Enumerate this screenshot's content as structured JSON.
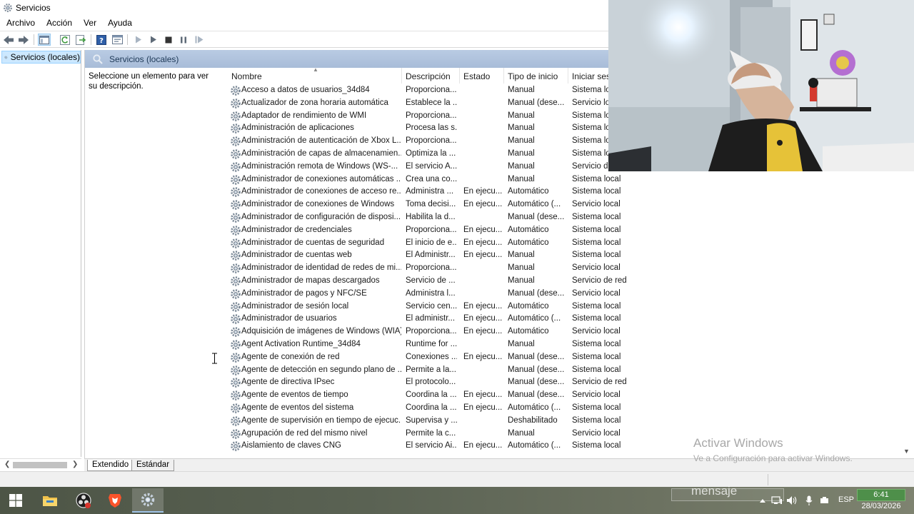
{
  "window": {
    "title": "Servicios"
  },
  "menu": [
    "Archivo",
    "Acción",
    "Ver",
    "Ayuda"
  ],
  "tree": {
    "item": "Servicios (locales)"
  },
  "panel": {
    "header": "Servicios (locales)",
    "description": "Seleccione un elemento para ver su descripción."
  },
  "columns": [
    "Nombre",
    "Descripción",
    "Estado",
    "Tipo de inicio",
    "Iniciar sesi"
  ],
  "services": [
    [
      "Acceso a datos de usuarios_34d84",
      "Proporciona...",
      "",
      "Manual",
      "Sistema lo"
    ],
    [
      "Actualizador de zona horaria automática",
      "Establece la ...",
      "",
      "Manual (dese...",
      "Servicio lo"
    ],
    [
      "Adaptador de rendimiento de WMI",
      "Proporciona...",
      "",
      "Manual",
      "Sistema lo"
    ],
    [
      "Administración de aplicaciones",
      "Procesa las s...",
      "",
      "Manual",
      "Sistema lo"
    ],
    [
      "Administración de autenticación de Xbox L...",
      "Proporciona...",
      "",
      "Manual",
      "Sistema lo"
    ],
    [
      "Administración de capas de almacenamien...",
      "Optimiza la ...",
      "",
      "Manual",
      "Sistema lo"
    ],
    [
      "Administración remota de Windows (WS-...",
      "El servicio A...",
      "",
      "Manual",
      "Servicio de"
    ],
    [
      "Administrador de conexiones automáticas ...",
      "Crea una co...",
      "",
      "Manual",
      "Sistema local"
    ],
    [
      "Administrador de conexiones de acceso re...",
      "Administra ...",
      "En ejecu...",
      "Automático",
      "Sistema local"
    ],
    [
      "Administrador de conexiones de Windows",
      "Toma decisi...",
      "En ejecu...",
      "Automático (...",
      "Servicio local"
    ],
    [
      "Administrador de configuración de disposi...",
      "Habilita la d...",
      "",
      "Manual (dese...",
      "Sistema local"
    ],
    [
      "Administrador de credenciales",
      "Proporciona...",
      "En ejecu...",
      "Automático",
      "Sistema local"
    ],
    [
      "Administrador de cuentas de seguridad",
      "El inicio de e...",
      "En ejecu...",
      "Automático",
      "Sistema local"
    ],
    [
      "Administrador de cuentas web",
      "El Administr...",
      "En ejecu...",
      "Manual",
      "Sistema local"
    ],
    [
      "Administrador de identidad de redes de mi...",
      "Proporciona...",
      "",
      "Manual",
      "Servicio local"
    ],
    [
      "Administrador de mapas descargados",
      "Servicio de ...",
      "",
      "Manual",
      "Servicio de red"
    ],
    [
      "Administrador de pagos y NFC/SE",
      "Administra l...",
      "",
      "Manual (dese...",
      "Servicio local"
    ],
    [
      "Administrador de sesión local",
      "Servicio cen...",
      "En ejecu...",
      "Automático",
      "Sistema local"
    ],
    [
      "Administrador de usuarios",
      "El administr...",
      "En ejecu...",
      "Automático (...",
      "Sistema local"
    ],
    [
      "Adquisición de imágenes de Windows (WIA)",
      "Proporciona...",
      "En ejecu...",
      "Automático",
      "Servicio local"
    ],
    [
      "Agent Activation Runtime_34d84",
      "Runtime for ...",
      "",
      "Manual",
      "Sistema local"
    ],
    [
      "Agente de conexión de red",
      "Conexiones ...",
      "En ejecu...",
      "Manual (dese...",
      "Sistema local"
    ],
    [
      "Agente de detección en segundo plano de ...",
      "Permite a la...",
      "",
      "Manual (dese...",
      "Sistema local"
    ],
    [
      "Agente de directiva IPsec",
      "El protocolo...",
      "",
      "Manual (dese...",
      "Servicio de red"
    ],
    [
      "Agente de eventos de tiempo",
      "Coordina la ...",
      "En ejecu...",
      "Manual (dese...",
      "Servicio local"
    ],
    [
      "Agente de eventos del sistema",
      "Coordina la ...",
      "En ejecu...",
      "Automático (...",
      "Sistema local"
    ],
    [
      "Agente de supervisión en tiempo de ejecuc...",
      "Supervisa y ...",
      "",
      "Deshabilitado",
      "Sistema local"
    ],
    [
      "Agrupación de red del mismo nivel",
      "Permite la c...",
      "",
      "Manual",
      "Servicio local"
    ],
    [
      "Aislamiento de claves CNG",
      "El servicio Ai...",
      "En ejecu...",
      "Automático (...",
      "Sistema local"
    ]
  ],
  "tabs": {
    "extended": "Extendido",
    "standard": "Estándar"
  },
  "watermark": {
    "line1": "Activar Windows",
    "line2": "Ve a Configuración para activar Windows."
  },
  "overlay": {
    "ghost_text": "mensaje"
  },
  "taskbar": {
    "language": "ESP",
    "time": "6:41",
    "date": "28/03/2026",
    "accent": "#4e8f4a"
  }
}
